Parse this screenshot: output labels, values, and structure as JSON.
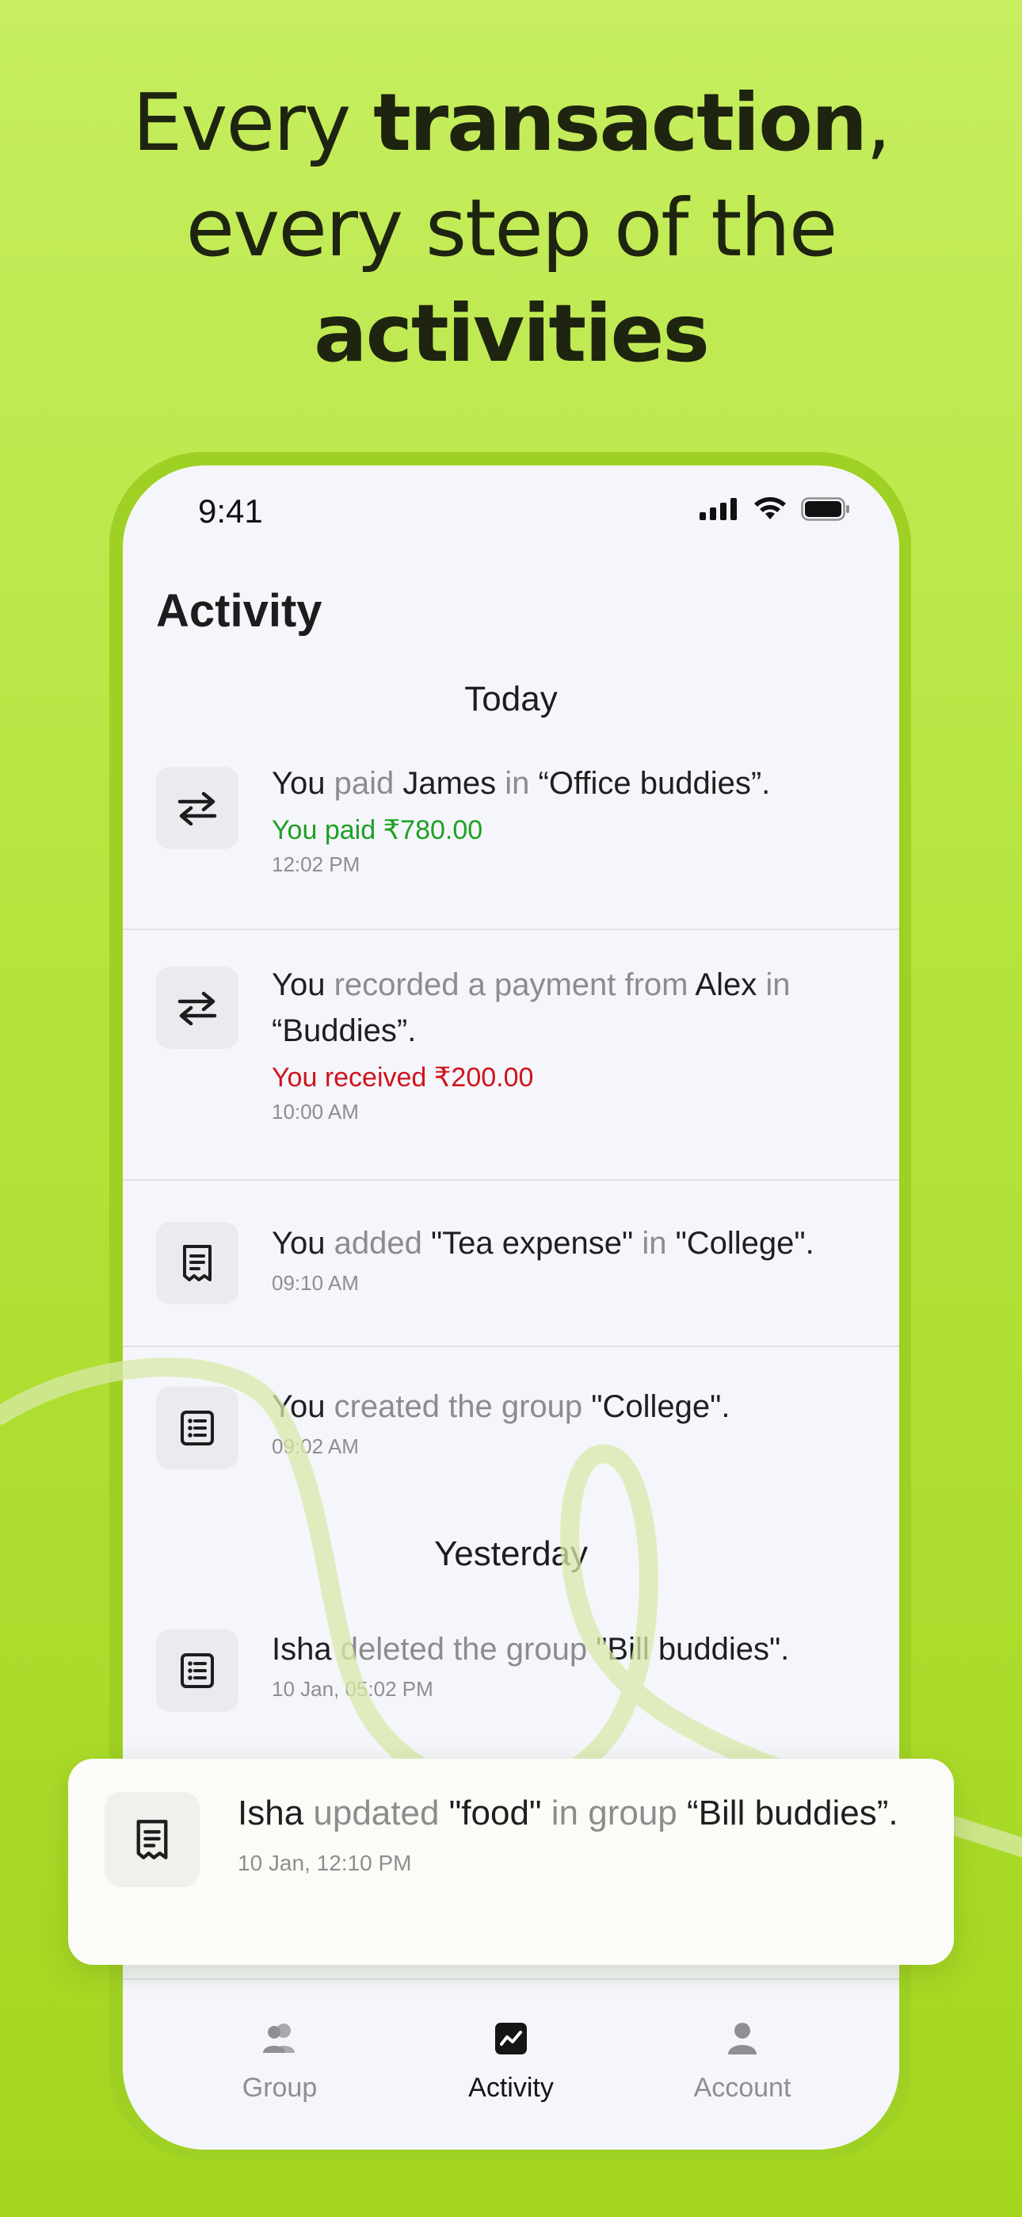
{
  "headline": {
    "line1_light": "Every ",
    "line1_bold": "transaction",
    "line1_end": ",",
    "line2": "every step of the",
    "line3_bold": "activities"
  },
  "status_bar": {
    "time": "9:41"
  },
  "screen_title": "Activity",
  "sections": {
    "today": "Today",
    "yesterday": "Yesterday"
  },
  "activities": [
    {
      "icon": "transfer-arrows-icon",
      "parts": [
        "You",
        " paid ",
        "James",
        " in ",
        "“Office buddies”."
      ],
      "amount": "You paid ₹780.00",
      "amount_color": "#1ea023",
      "time": "12:02 PM"
    },
    {
      "icon": "transfer-arrows-icon",
      "parts": [
        "You",
        " recorded a payment from ",
        "Alex",
        " in ",
        "“Buddies”."
      ],
      "amount": "You received ₹200.00",
      "amount_color": "#d0141b",
      "time": "10:00 AM"
    },
    {
      "icon": "receipt-icon",
      "parts": [
        "You",
        " added ",
        "\"Tea expense\"",
        " in ",
        "\"College\"."
      ],
      "time": "09:10 AM"
    },
    {
      "icon": "list-icon",
      "parts": [
        "You",
        " created the group ",
        "\"College\"."
      ],
      "time": "09:02 AM"
    },
    {
      "icon": "list-icon",
      "parts": [
        "Isha",
        " deleted the group ",
        "\"Bill buddies\"."
      ],
      "time": "10 Jan, 05:02 PM"
    }
  ],
  "highlight_card": {
    "icon": "receipt-icon",
    "parts": [
      "Isha",
      " updated ",
      "\"food\"",
      " in group ",
      "“Bill buddies”."
    ],
    "time": "10 Jan, 12:10 PM"
  },
  "nav": {
    "group": "Group",
    "activity": "Activity",
    "account": "Account"
  },
  "colors": {
    "accent_green": "#1ea023",
    "alert_red": "#d0141b",
    "background_lime": "#b4e33c"
  }
}
